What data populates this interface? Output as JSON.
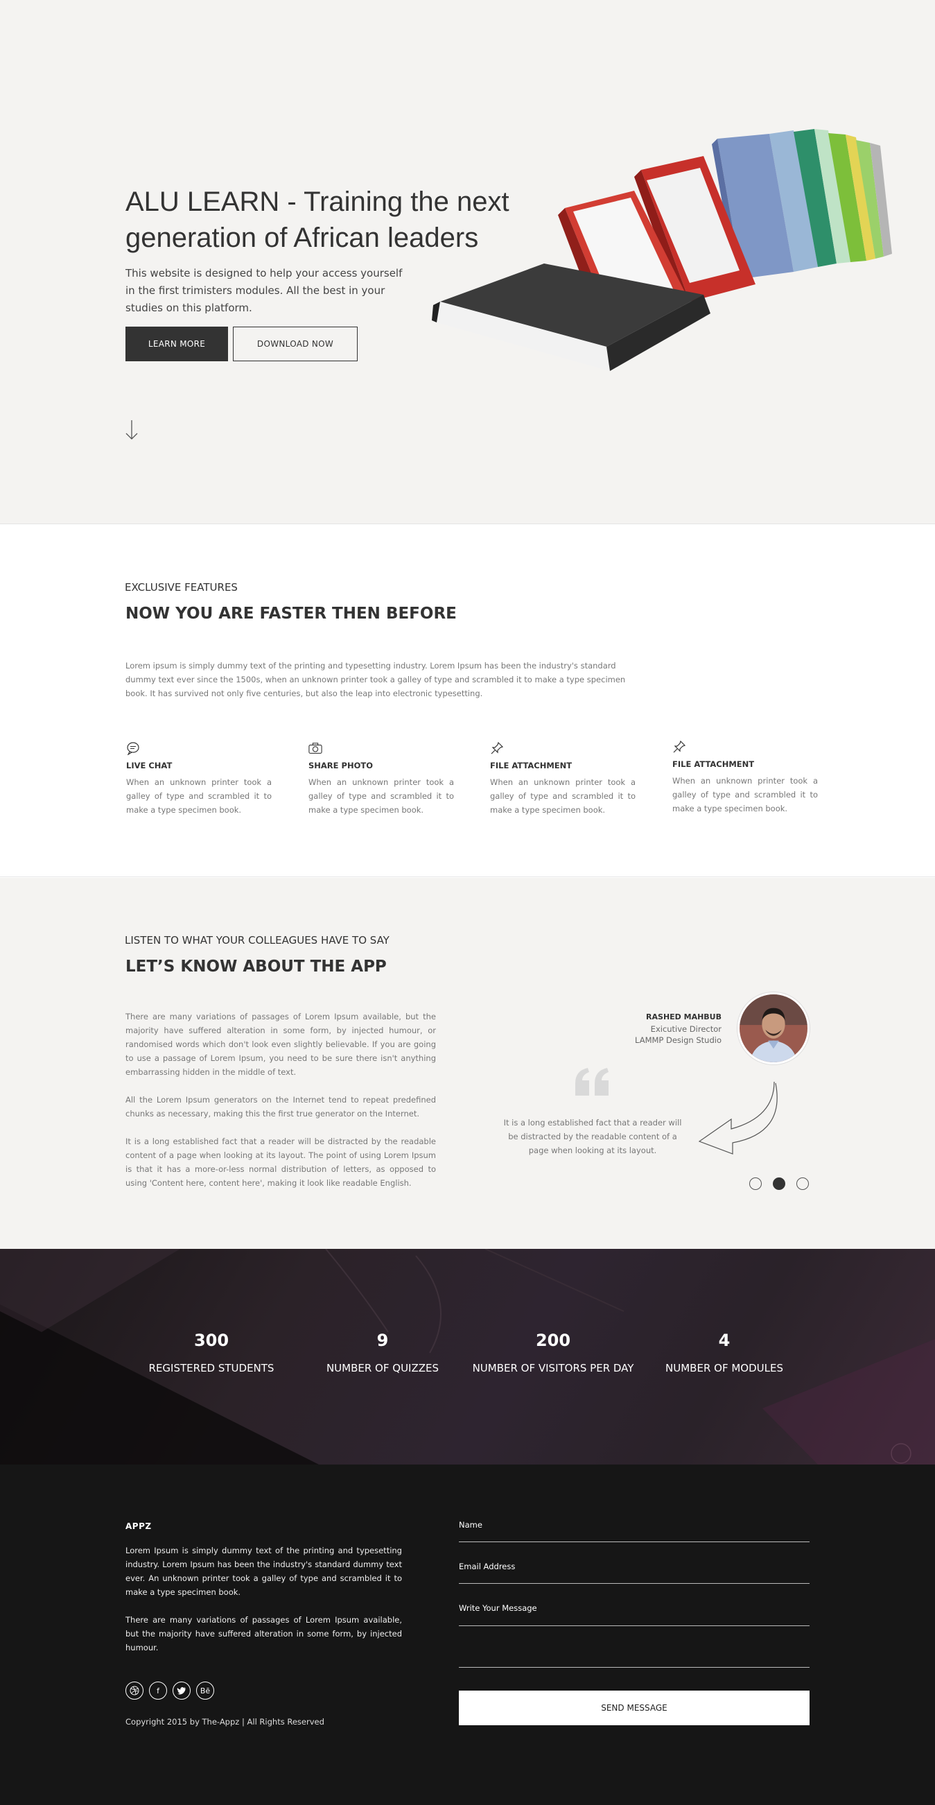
{
  "hero": {
    "title": "ALU LEARN - Training the next generation of African leaders",
    "description": "This website is designed to help your access yourself in the first trimisters modules. All the best in your studies on this platform.",
    "learn_more_label": "LEARN MORE",
    "download_label": "DOWNLOAD NOW"
  },
  "features": {
    "eyebrow": "EXCLUSIVE FEATURES",
    "title": "NOW YOU ARE FASTER THEN BEFORE",
    "intro": "Lorem ipsum is simply dummy text of the printing and typesetting industry. Lorem Ipsum has been the industry's standard dummy text ever since the 1500s, when an unknown printer took a galley of type and scrambled it to make a type specimen book. It has survived not only five centuries, but also the leap into electronic typesetting.",
    "items": [
      {
        "icon": "chat-bubble-icon",
        "title": "LIVE CHAT",
        "text": "When an unknown printer took a galley of type and scrambled it to make a type specimen book."
      },
      {
        "icon": "camera-icon",
        "title": "SHARE PHOTO",
        "text": "When an unknown printer took a galley of type and scrambled it to make a type specimen book."
      },
      {
        "icon": "pin-icon",
        "title": "FILE ATTACHMENT",
        "text": "When an unknown printer took a galley of type and scrambled it to make a type specimen book."
      },
      {
        "icon": "pin-icon",
        "title": "FILE ATTACHMENT",
        "text": "When an unknown printer took a galley of type and scrambled it to make a type specimen book."
      }
    ]
  },
  "testimonials": {
    "eyebrow": "LISTEN TO WHAT YOUR COLLEAGUES HAVE TO SAY",
    "title": "LET’S KNOW ABOUT THE APP",
    "paragraphs": [
      "There are many variations of passages of Lorem Ipsum available, but the majority have suffered alteration in some form, by injected humour, or randomised words which don't look even slightly believable. If you are going to use a passage of Lorem Ipsum, you need to be sure there isn't anything embarrassing hidden in the middle of text.",
      "All the Lorem Ipsum generators on the Internet tend to repeat predefined chunks as necessary, making this the first true generator on the Internet.",
      "It is a long established fact that a reader will be distracted by the readable content of a page when looking at its layout. The point of using Lorem Ipsum is that it has a more-or-less normal distribution of letters, as opposed to using 'Content here, content here', making it look like readable English."
    ],
    "person_name": "RASHED MAHBUB",
    "person_role": "Exicutive Director",
    "person_company": "LAMMP Design Studio",
    "quote": "It is a long established fact that a reader will be distracted by the readable content of a page when looking at its layout.",
    "slides": 3,
    "active_slide": 2
  },
  "stats": [
    {
      "value": "300",
      "label": "REGISTERED STUDENTS"
    },
    {
      "value": "9",
      "label": "NUMBER OF QUIZZES"
    },
    {
      "value": "200",
      "label": "NUMBER OF VISITORS PER DAY"
    },
    {
      "value": "4",
      "label": "NUMBER OF MODULES"
    }
  ],
  "footer": {
    "brand": "APPZ",
    "paragraph1": "Lorem Ipsum is simply dummy text of the printing and typesetting industry. Lorem Ipsum has been the industry's standard dummy text ever. An unknown printer took a galley of type and scrambled it to make a type specimen book.",
    "paragraph2": "There are many variations of passages of Lorem Ipsum available, but the majority have suffered alteration in some form, by injected humour.",
    "socials": [
      "dribbble-icon",
      "facebook-icon",
      "twitter-icon",
      "behance-icon"
    ],
    "copyright": "Copyright 2015 by The-Appz | All Rights Reserved",
    "form": {
      "name_label": "Name",
      "email_label": "Email Address",
      "message_label": "Write Your Message",
      "send_label": "SEND MESSAGE"
    }
  }
}
